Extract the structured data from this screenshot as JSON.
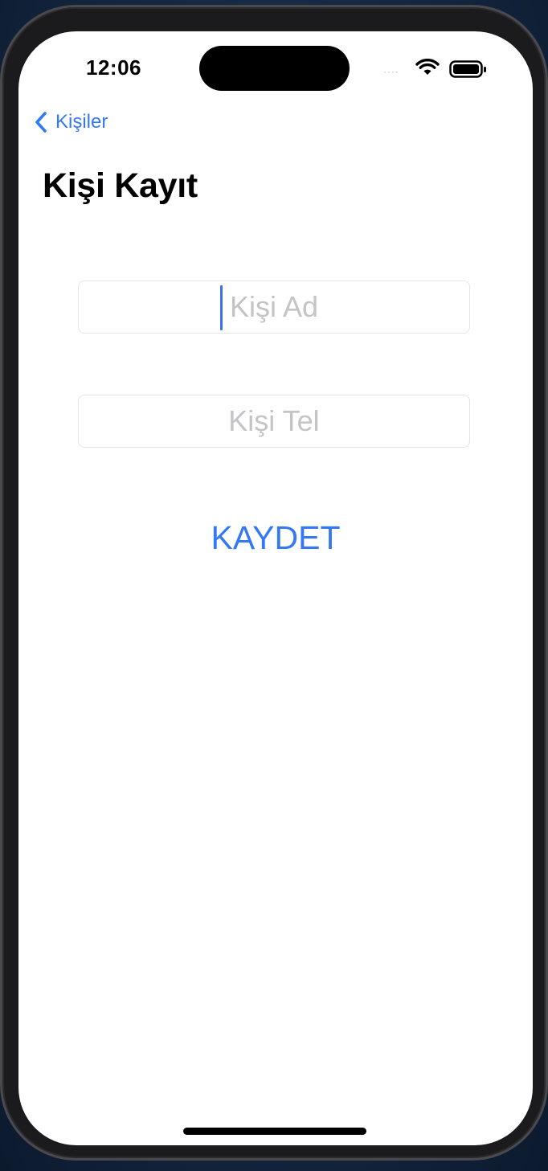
{
  "status_bar": {
    "time": "12:06",
    "signal_icon": "signal-dots-icon",
    "wifi_icon": "wifi-icon",
    "battery_icon": "battery-icon"
  },
  "nav": {
    "back_icon": "chevron-left-icon",
    "back_label": "Kişiler"
  },
  "page": {
    "title": "Kişi Kayıt"
  },
  "form": {
    "name_field": {
      "placeholder": "Kişi Ad",
      "value": ""
    },
    "phone_field": {
      "placeholder": "Kişi Tel",
      "value": ""
    },
    "save_label": "KAYDET"
  },
  "colors": {
    "accent": "#3478f6",
    "placeholder": "#c4c4c7",
    "background": "#ffffff"
  }
}
